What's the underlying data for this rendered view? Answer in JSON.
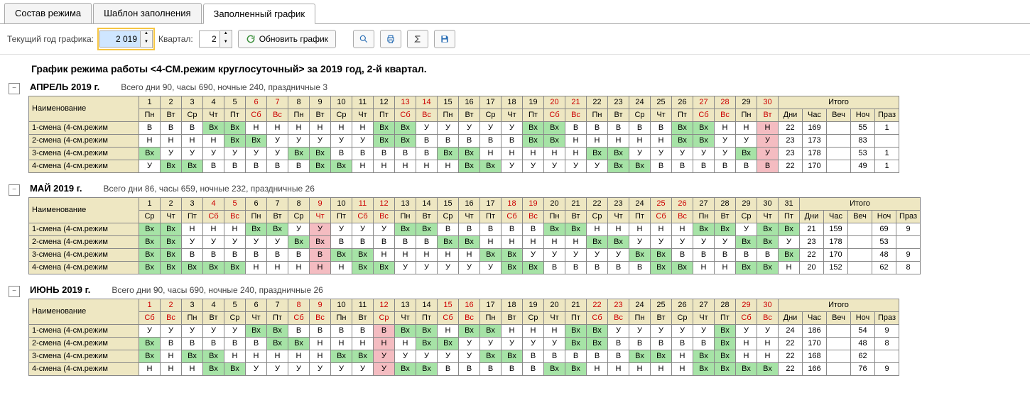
{
  "tabs": [
    "Состав режима",
    "Шаблон заполнения",
    "Заполненный график"
  ],
  "activeTab": 2,
  "toolbar": {
    "yearLabel": "Текущий год графика:",
    "year": "2 019",
    "quarterLabel": "Квартал:",
    "quarter": "2",
    "refresh": "Обновить график"
  },
  "title": "График режима работы <4-СМ.режим круглосуточный> за 2019 год, 2-й квартал.",
  "sumHeaders": [
    "Дни",
    "Час",
    "Веч",
    "Ноч",
    "Праз"
  ],
  "totalsLabel": "Итого",
  "nameHeader": "Наименование",
  "months": [
    {
      "title": "АПРЕЛЬ 2019 г.",
      "summary": "Всего дни 90, часы 690, ночные 240, праздничные 3",
      "redDays": [
        6,
        7,
        13,
        14,
        20,
        21,
        27,
        28,
        30
      ],
      "holDays": [
        30
      ],
      "days": 30,
      "weekStart": 0,
      "rows": [
        {
          "name": "1-смена (4-см.режим",
          "cells": [
            "В",
            "В",
            "В",
            "Вх",
            "Вх",
            "Н",
            "Н",
            "Н",
            "Н",
            "Н",
            "Н",
            "Вх",
            "Вх",
            "У",
            "У",
            "У",
            "У",
            "У",
            "Вх",
            "Вх",
            "В",
            "В",
            "В",
            "В",
            "В",
            "Вх",
            "Вх",
            "Н",
            "Н",
            "Н"
          ],
          "totals": [
            "22",
            "169",
            "",
            "55",
            "1"
          ]
        },
        {
          "name": "2-смена (4-см.режим",
          "cells": [
            "Н",
            "Н",
            "Н",
            "Н",
            "Вх",
            "Вх",
            "У",
            "У",
            "У",
            "У",
            "У",
            "Вх",
            "Вх",
            "В",
            "В",
            "В",
            "В",
            "В",
            "Вх",
            "Вх",
            "Н",
            "Н",
            "Н",
            "Н",
            "Н",
            "Вх",
            "Вх",
            "У",
            "У",
            "У"
          ],
          "totals": [
            "23",
            "173",
            "",
            "83",
            ""
          ]
        },
        {
          "name": "3-смена (4-см.режим",
          "cells": [
            "Вх",
            "У",
            "У",
            "У",
            "У",
            "У",
            "У",
            "Вх",
            "Вх",
            "В",
            "В",
            "В",
            "В",
            "В",
            "Вх",
            "Вх",
            "Н",
            "Н",
            "Н",
            "Н",
            "Н",
            "Вх",
            "Вх",
            "У",
            "У",
            "У",
            "У",
            "У",
            "Вх",
            "У"
          ],
          "totals": [
            "23",
            "178",
            "",
            "53",
            "1"
          ]
        },
        {
          "name": "4-смена (4-см.режим",
          "cells": [
            "У",
            "Вх",
            "Вх",
            "В",
            "В",
            "В",
            "В",
            "В",
            "Вх",
            "Вх",
            "Н",
            "Н",
            "Н",
            "Н",
            "Н",
            "Вх",
            "Вх",
            "У",
            "У",
            "У",
            "У",
            "У",
            "Вх",
            "Вх",
            "В",
            "В",
            "В",
            "В",
            "В",
            "В"
          ],
          "totals": [
            "22",
            "170",
            "",
            "49",
            "1"
          ]
        }
      ]
    },
    {
      "title": "МАЙ 2019 г.",
      "summary": "Всего дни 86, часы 659, ночные 232, праздничные 26",
      "redDays": [
        4,
        5,
        9,
        11,
        12,
        18,
        19,
        25,
        26
      ],
      "holDays": [
        9
      ],
      "days": 31,
      "weekStart": 2,
      "rows": [
        {
          "name": "1-смена (4-см.режим",
          "cells": [
            "Вх",
            "Вх",
            "Н",
            "Н",
            "Н",
            "Вх",
            "Вх",
            "У",
            "У",
            "У",
            "У",
            "У",
            "Вх",
            "Вх",
            "В",
            "В",
            "В",
            "В",
            "В",
            "Вх",
            "Вх",
            "Н",
            "Н",
            "Н",
            "Н",
            "Н",
            "Вх",
            "Вх",
            "У",
            "Вх",
            "Вх"
          ],
          "totals": [
            "21",
            "159",
            "",
            "69",
            "9"
          ]
        },
        {
          "name": "2-смена (4-см.режим",
          "cells": [
            "Вх",
            "Вх",
            "У",
            "У",
            "У",
            "У",
            "У",
            "Вх",
            "Вх",
            "В",
            "В",
            "В",
            "В",
            "В",
            "Вх",
            "Вх",
            "Н",
            "Н",
            "Н",
            "Н",
            "Н",
            "Вх",
            "Вх",
            "У",
            "У",
            "У",
            "У",
            "У",
            "Вх",
            "Вх",
            "У"
          ],
          "totals": [
            "23",
            "178",
            "",
            "53",
            ""
          ]
        },
        {
          "name": "3-смена (4-см.режим",
          "cells": [
            "Вх",
            "Вх",
            "В",
            "В",
            "В",
            "В",
            "В",
            "В",
            "В",
            "Вх",
            "Вх",
            "Н",
            "Н",
            "Н",
            "Н",
            "Н",
            "Вх",
            "Вх",
            "У",
            "У",
            "У",
            "У",
            "У",
            "Вх",
            "Вх",
            "В",
            "В",
            "В",
            "В",
            "В",
            "Вх"
          ],
          "totals": [
            "22",
            "170",
            "",
            "48",
            "9"
          ]
        },
        {
          "name": "4-смена (4-см.режим",
          "cells": [
            "Вх",
            "Вх",
            "Вх",
            "Вх",
            "Вх",
            "Н",
            "Н",
            "Н",
            "Н",
            "Н",
            "Вх",
            "Вх",
            "У",
            "У",
            "У",
            "У",
            "У",
            "Вх",
            "Вх",
            "В",
            "В",
            "В",
            "В",
            "В",
            "Вх",
            "Вх",
            "Н",
            "Н",
            "Вх",
            "Вх",
            "Н"
          ],
          "totals": [
            "20",
            "152",
            "",
            "62",
            "8"
          ]
        }
      ]
    },
    {
      "title": "ИЮНЬ 2019 г.",
      "summary": "Всего дни 90, часы 690, ночные 240, праздничные 26",
      "redDays": [
        1,
        2,
        8,
        9,
        12,
        15,
        16,
        22,
        23,
        29,
        30
      ],
      "holDays": [
        12
      ],
      "days": 30,
      "weekStart": 5,
      "rows": [
        {
          "name": "1-смена (4-см.режим",
          "cells": [
            "У",
            "У",
            "У",
            "У",
            "У",
            "Вх",
            "Вх",
            "В",
            "В",
            "В",
            "В",
            "В",
            "Вх",
            "Вх",
            "Н",
            "Вх",
            "Вх",
            "Н",
            "Н",
            "Н",
            "Вх",
            "Вх",
            "У",
            "У",
            "У",
            "У",
            "У",
            "Вх",
            "У",
            "У"
          ],
          "totals": [
            "24",
            "186",
            "",
            "54",
            "9"
          ]
        },
        {
          "name": "2-смена (4-см.режим",
          "cells": [
            "Вх",
            "В",
            "В",
            "В",
            "В",
            "В",
            "Вх",
            "Вх",
            "Н",
            "Н",
            "Н",
            "Н",
            "Н",
            "Вх",
            "Вх",
            "У",
            "У",
            "У",
            "У",
            "У",
            "Вх",
            "Вх",
            "В",
            "В",
            "В",
            "В",
            "В",
            "Вх",
            "Н",
            "Н"
          ],
          "totals": [
            "22",
            "170",
            "",
            "48",
            "8"
          ]
        },
        {
          "name": "3-смена (4-см.режим",
          "cells": [
            "Вх",
            "Н",
            "Вх",
            "Вх",
            "Н",
            "Н",
            "Н",
            "Н",
            "Н",
            "Вх",
            "Вх",
            "У",
            "У",
            "У",
            "У",
            "У",
            "Вх",
            "Вх",
            "В",
            "В",
            "В",
            "В",
            "В",
            "Вх",
            "Вх",
            "Н",
            "Вх",
            "Вх",
            "Н",
            "Н"
          ],
          "totals": [
            "22",
            "168",
            "",
            "62",
            ""
          ]
        },
        {
          "name": "4-смена (4-см.режим",
          "cells": [
            "Н",
            "Н",
            "Н",
            "Вх",
            "Вх",
            "У",
            "У",
            "У",
            "У",
            "У",
            "У",
            "У",
            "Вх",
            "Вх",
            "В",
            "В",
            "В",
            "В",
            "В",
            "Вх",
            "Вх",
            "Н",
            "Н",
            "Н",
            "Н",
            "Н",
            "Вх",
            "Вх",
            "Вх",
            "Вх"
          ],
          "totals": [
            "22",
            "166",
            "",
            "76",
            "9"
          ]
        }
      ]
    }
  ],
  "weekdays": [
    "Пн",
    "Вт",
    "Ср",
    "Чт",
    "Пт",
    "Сб",
    "Вс"
  ]
}
